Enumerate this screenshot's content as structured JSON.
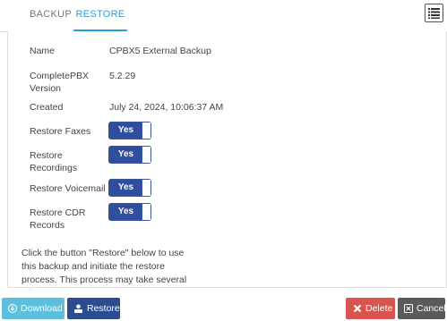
{
  "tabs": [
    {
      "label": "BACKUP",
      "active": false
    },
    {
      "label": "RESTORE",
      "active": true
    }
  ],
  "fields": {
    "name": {
      "label": "Name",
      "value": "CPBX5 External Backup"
    },
    "version": {
      "label": "CompletePBX Version",
      "value": "5.2.29"
    },
    "created": {
      "label": "Created",
      "value": "July 24, 2024, 10:06:37 AM"
    }
  },
  "toggles": [
    {
      "label": "Restore Faxes",
      "value": "Yes"
    },
    {
      "label": "Restore Recordings",
      "value": "Yes"
    },
    {
      "label": "Restore Voicemail",
      "value": "Yes"
    },
    {
      "label": "Restore CDR Records",
      "value": "Yes"
    }
  ],
  "description": "Click the button \"Restore\" below to use this backup and initiate the restore process. This process may take several minutes.",
  "buttons": {
    "download": "Download",
    "restore": "Restore",
    "delete": "Delete",
    "cancel": "Cancel"
  },
  "colors": {
    "accent": "#2a9fd6",
    "toggle": "#2f4f9e",
    "download": "#5bc0de",
    "restore": "#2b4c8f",
    "delete": "#d9534f",
    "cancel": "#5a5a5a"
  },
  "icons": [
    "list-icon",
    "download-icon",
    "restore-icon",
    "close-icon",
    "cancel-icon"
  ]
}
